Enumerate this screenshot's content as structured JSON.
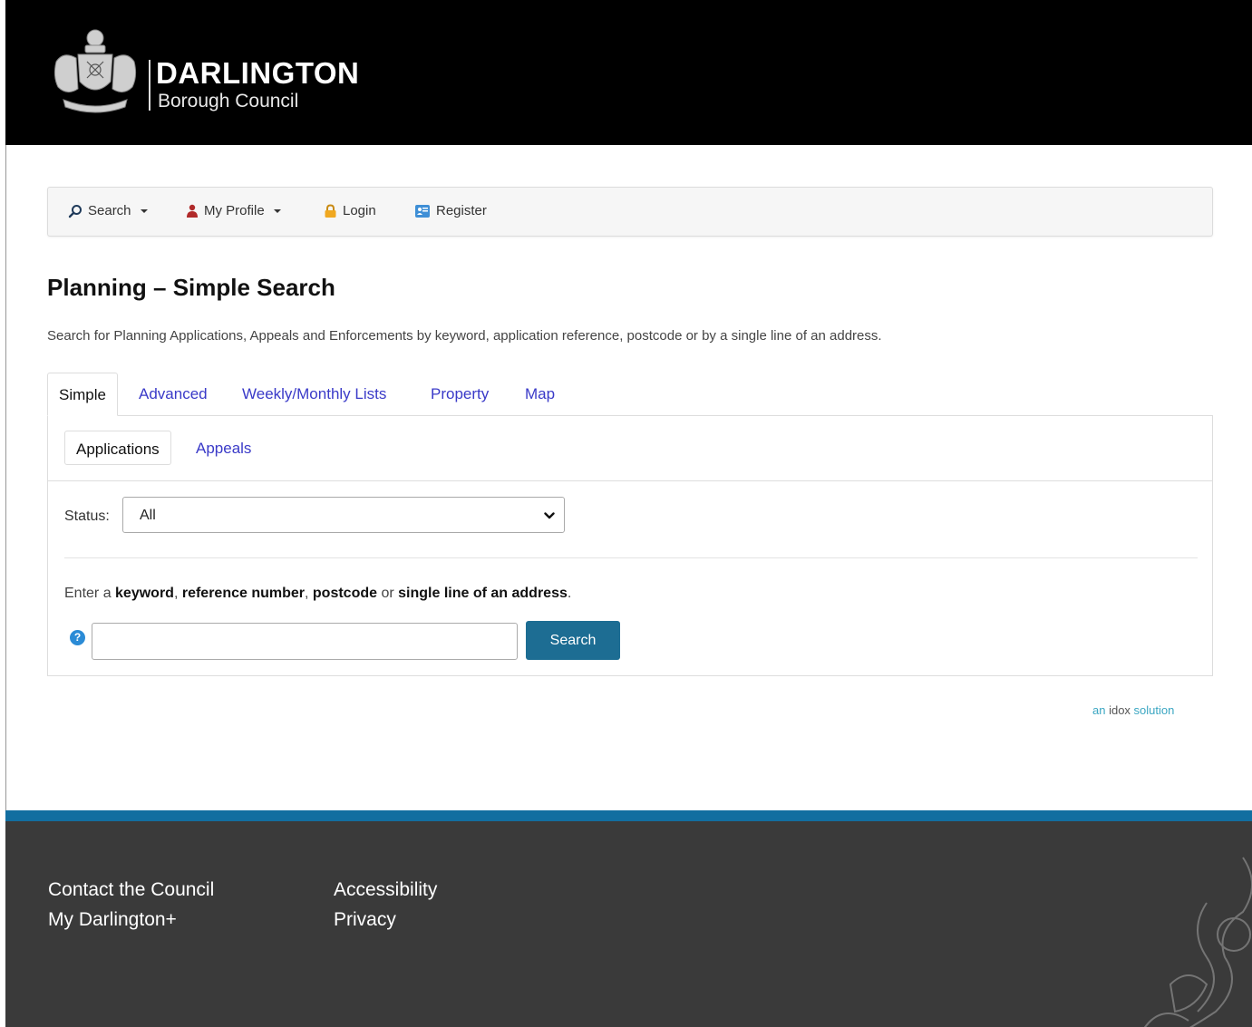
{
  "header": {
    "brand_name": "DARLINGTON",
    "brand_sub": "Borough Council"
  },
  "nav": {
    "search": "Search",
    "my_profile": "My Profile",
    "login": "Login",
    "register": "Register"
  },
  "page": {
    "title_bold": "Planning",
    "title_rest": " – Simple Search",
    "description": "Search for Planning Applications, Appeals and Enforcements by keyword, application reference, postcode or by a single line of an address."
  },
  "tabs": [
    {
      "label": "Simple",
      "active": true
    },
    {
      "label": "Advanced",
      "active": false
    },
    {
      "label": "Weekly/Monthly Lists",
      "active": false
    },
    {
      "label": "Property",
      "active": false
    },
    {
      "label": "Map",
      "active": false
    }
  ],
  "subtabs": [
    {
      "label": "Applications",
      "active": true
    },
    {
      "label": "Appeals",
      "active": false
    }
  ],
  "form": {
    "status_label": "Status:",
    "status_value": "All",
    "prompt": {
      "p1": "Enter a ",
      "b1": "keyword",
      "p2": ", ",
      "b2": "reference number",
      "p3": ", ",
      "b3": "postcode",
      "p4": " or ",
      "b4": "single line of an address",
      "p5": "."
    },
    "search_value": "",
    "search_button": "Search",
    "help_glyph": "?"
  },
  "idox": {
    "prefix": "an ",
    "mid": "idox",
    "suffix": " solution"
  },
  "footer": {
    "contact": "Contact the Council",
    "my_darlington": "My Darlington+",
    "accessibility": "Accessibility",
    "privacy": "Privacy"
  },
  "colors": {
    "header_bg": "#000000",
    "link": "#3a3ac8",
    "search_button": "#1d6d93",
    "footer_stripe": "#126ea0",
    "footer_bg": "#3a3a3a"
  },
  "icons": {
    "search": "search-icon",
    "profile": "user-icon",
    "login": "lock-icon",
    "register": "register-icon",
    "help": "help-icon",
    "select": "chevron-down-icon"
  }
}
